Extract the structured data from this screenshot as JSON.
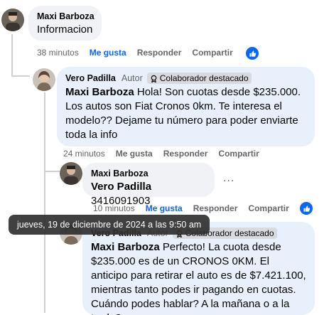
{
  "comment1": {
    "author": "Maxi Barboza",
    "text": "Informacion",
    "time": "38 minutos",
    "like": "Me gusta",
    "reply": "Responder",
    "share": "Compartir"
  },
  "reply1": {
    "author": "Vero Padilla",
    "author_tag": "Autor",
    "badge": "Colaborador destacado",
    "mention": "Maxi Barboza",
    "text": "Hola! Son cuotas desde $235.000. Los autos son Fiat Cronos 0km. Te interesa el modelo?? Dejame tu número para poder enviarte toda la info",
    "time": "24 minutos",
    "like": "Me gusta",
    "reply": "Responder",
    "share": "Compartir"
  },
  "reply2": {
    "author": "Maxi Barboza",
    "mention": "Vero Padilla",
    "text": "3416091903",
    "time": "10 minutos",
    "like": "Me gusta",
    "reply": "Responder",
    "share": "Compartir",
    "more": "..."
  },
  "reply3": {
    "author": "Vero Padilla",
    "author_tag": "Autor",
    "badge": "Colaborador destacado",
    "mention": "Maxi Barboza",
    "text": "Perfecto! La cuota desde $235.000 es de un CRONOS 0KM. El anticipo para retirar el auto es de $7.421.100, mientras tanto podes ir pagando en cuotas. Cuándo podes hablar? A la mañana o a la tarde?"
  },
  "tooltip": {
    "text": "jueves, 19 de diciembre de 2024 a las 9:50 am"
  },
  "colors": {
    "accent": "#0866ff",
    "bubble_grey": "#f0f2f5",
    "bubble_blue": "#e7f0fb"
  }
}
